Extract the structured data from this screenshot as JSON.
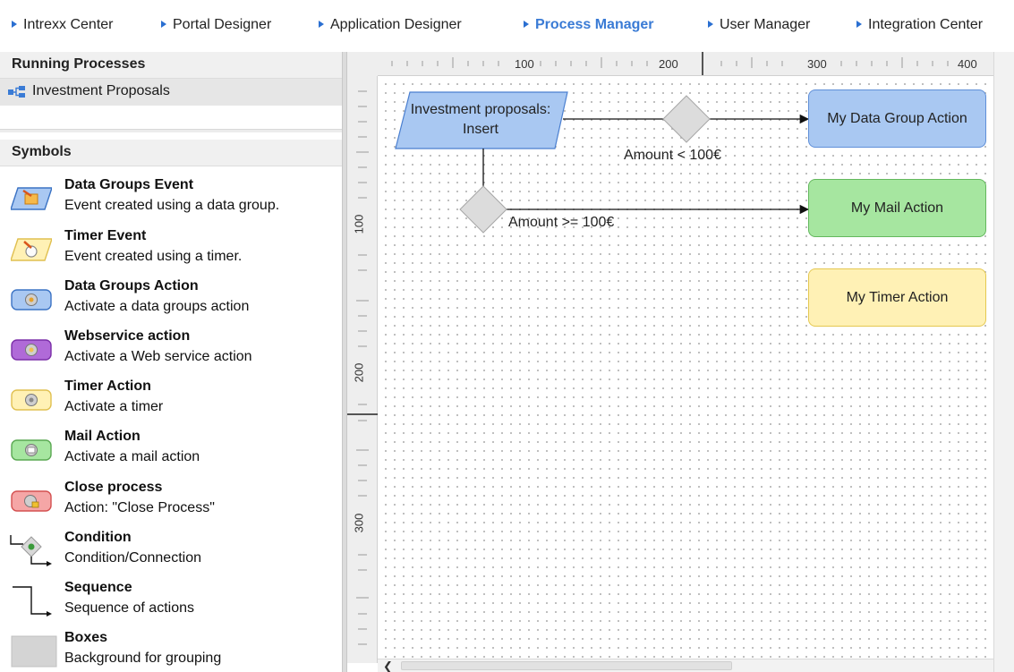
{
  "nav": {
    "items": [
      {
        "label": "Intrexx Center",
        "active": false
      },
      {
        "label": "Portal Designer",
        "active": false
      },
      {
        "label": "Application Designer",
        "active": false
      },
      {
        "label": "Process Manager",
        "active": true
      },
      {
        "label": "User Manager",
        "active": false
      },
      {
        "label": "Integration Center",
        "active": false
      }
    ]
  },
  "sidebar": {
    "running_title": "Running Processes",
    "process": "Investment Proposals",
    "symbols_title": "Symbols",
    "symbols": [
      {
        "title": "Data Groups Event",
        "desc": "Event created using a data group.",
        "icon": "data-group-event-icon"
      },
      {
        "title": "Timer Event",
        "desc": "Event created using a timer.",
        "icon": "timer-event-icon"
      },
      {
        "title": "Data Groups Action",
        "desc": "Activate a data groups action",
        "icon": "data-group-action-icon"
      },
      {
        "title": "Webservice action",
        "desc": "Activate a Web service action",
        "icon": "webservice-action-icon"
      },
      {
        "title": "Timer Action",
        "desc": "Activate a timer",
        "icon": "timer-action-icon"
      },
      {
        "title": "Mail Action",
        "desc": "Activate a mail action",
        "icon": "mail-action-icon"
      },
      {
        "title": "Close process",
        "desc": "Action: \"Close Process\"",
        "icon": "close-process-icon"
      },
      {
        "title": "Condition",
        "desc": "Condition/Connection",
        "icon": "condition-icon"
      },
      {
        "title": "Sequence",
        "desc": "Sequence of actions",
        "icon": "sequence-icon"
      },
      {
        "title": "Boxes",
        "desc": "Background for grouping",
        "icon": "box-icon"
      }
    ]
  },
  "ruler": {
    "h": [
      "100",
      "200",
      "300",
      "400"
    ],
    "v": [
      "100",
      "200",
      "300"
    ]
  },
  "diagram": {
    "event": "Investment proposals: Insert",
    "action_group": "My Data Group Action",
    "action_mail": "My Mail Action",
    "action_timer": "My Timer Action",
    "cond1": "Amount < 100€",
    "cond2": "Amount >= 100€"
  },
  "colors": {
    "accent": "#3a7bd5",
    "group_action": "#a9c8f2",
    "mail_action": "#a6e6a0",
    "timer_action": "#fff1b5"
  }
}
